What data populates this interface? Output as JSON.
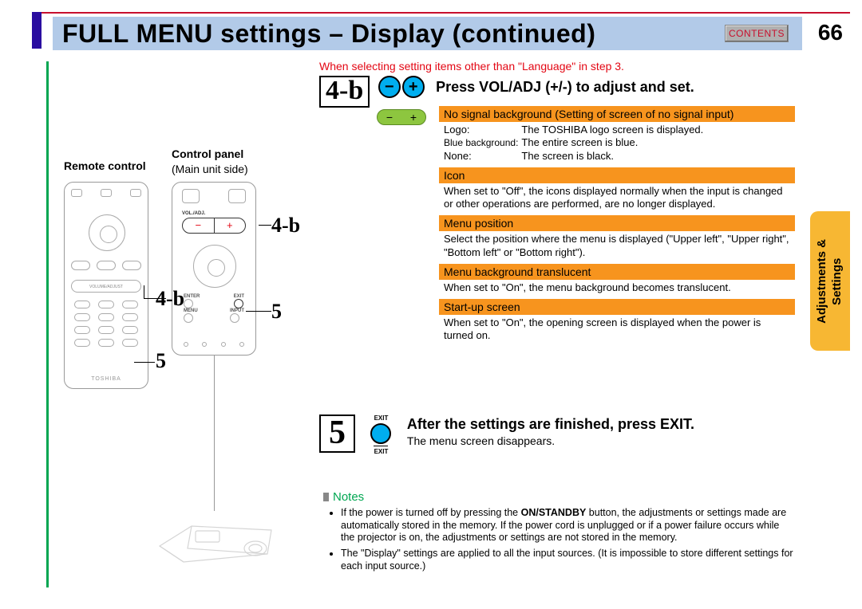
{
  "page": {
    "title": "FULL MENU settings – Display (continued)",
    "contents_btn": "CONTENTS",
    "page_number": "66",
    "side_tab": "Adjustments &\nSettings"
  },
  "left": {
    "remote_label": "Remote control",
    "control_label": "Control panel",
    "control_sub": "(Main unit side)",
    "voladj_small": "VOL./ADJ.",
    "vol_text": "VOLUME/ADJUST",
    "brand": "TOSHIBA",
    "btn_enter": "ENTER",
    "btn_exit": "EXIT",
    "btn_menu": "MENU",
    "btn_input": "INPUT",
    "callout_4b_a": "4-b",
    "callout_4b_b": "4-b",
    "callout_5_a": "5",
    "callout_5_b": "5"
  },
  "intro_red": "When selecting setting items other than \"Language\" in step 3.",
  "step4b": {
    "badge": "4-b",
    "minus": "−",
    "plus": "+",
    "bar_minus": "−",
    "bar_plus": "+",
    "heading": "Press VOL/ADJ (+/-) to adjust and set.",
    "items": [
      {
        "title": "No signal background (Setting of screen of no signal input)",
        "rows": [
          [
            "Logo:",
            "The TOSHIBA logo screen is displayed."
          ],
          [
            "Blue background:",
            "The entire screen is blue."
          ],
          [
            "None:",
            "The screen is black."
          ]
        ]
      },
      {
        "title": "Icon",
        "text": "When set to \"Off\", the icons displayed normally when the input is changed or other operations are performed, are no longer displayed."
      },
      {
        "title": "Menu position",
        "text": "Select the position where the menu is displayed (\"Upper left\", \"Upper right\", \"Bottom left\" or \"Bottom right\")."
      },
      {
        "title": "Menu background translucent",
        "text": "When set to \"On\", the menu background becomes translucent."
      },
      {
        "title": "Start-up screen",
        "text": "When set to \"On\", the opening screen is displayed when the power is turned on."
      }
    ]
  },
  "step5": {
    "badge": "5",
    "exit_top": "EXIT",
    "exit_bottom": "EXIT",
    "heading": "After the settings are finished, press EXIT.",
    "text": "The menu screen disappears."
  },
  "notes": {
    "header": "Notes",
    "items": [
      "If the power is turned off by pressing the <b>ON/STANDBY</b> button, the adjustments or settings made are automatically stored in the memory. If the power cord is unplugged or if a power failure occurs while the projector is on, the adjustments or settings are not stored in the memory.",
      "The \"Display\" settings are applied to all the input sources. (It is impossible to store different settings for each input source.)"
    ]
  }
}
